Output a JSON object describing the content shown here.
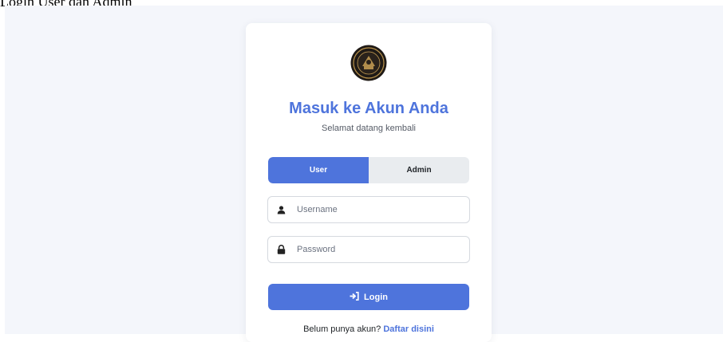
{
  "page_caption": "Login User dan Admin",
  "card": {
    "title": "Masuk ke Akun Anda",
    "subtitle": "Selamat datang kembali"
  },
  "tabs": [
    {
      "label": "User",
      "active": true
    },
    {
      "label": "Admin",
      "active": false
    }
  ],
  "form": {
    "username": {
      "placeholder": "Username",
      "value": "",
      "icon": "user-icon"
    },
    "password": {
      "placeholder": "Password",
      "value": "",
      "icon": "lock-icon"
    },
    "login_label": "Login",
    "login_icon": "sign-in-icon"
  },
  "register": {
    "prompt": "Belum punya akun?",
    "link_label": "Daftar disini"
  },
  "colors": {
    "accent": "#4e74dc",
    "page_bg": "#f4f6fb",
    "tab_inactive_bg": "#e9ecef"
  }
}
